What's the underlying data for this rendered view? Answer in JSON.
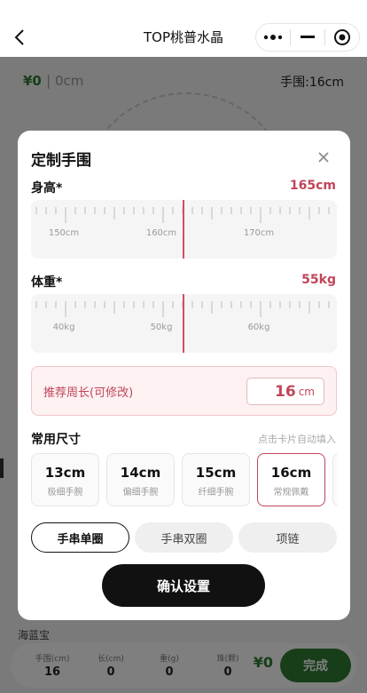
{
  "header": {
    "title": "TOP桃普水晶",
    "capsule": [
      "more-icon",
      "minimize-icon",
      "target-icon"
    ]
  },
  "background": {
    "price": "¥0",
    "length": "0cm",
    "wrist": "手围:16cm",
    "category": "海蓝宝",
    "stats": [
      {
        "label": "手围(cm)",
        "value": "16"
      },
      {
        "label": "长(cm)",
        "value": "0"
      },
      {
        "label": "重(g)",
        "value": "0"
      },
      {
        "label": "珠(颗)",
        "value": "0"
      }
    ],
    "total": "¥0",
    "done_label": "完成"
  },
  "modal": {
    "title": "定制手围",
    "height": {
      "label": "身高*",
      "value": "165cm",
      "tick_labels": [
        "150cm",
        "160cm",
        "170cm"
      ]
    },
    "weight": {
      "label": "体重*",
      "value": "55kg",
      "tick_labels": [
        "40kg",
        "50kg",
        "60kg"
      ]
    },
    "recommend": {
      "label": "推荐周长(可修改)",
      "value": "16",
      "unit": "cm"
    },
    "sizes": {
      "title": "常用尺寸",
      "hint": "点击卡片自动填入",
      "items": [
        {
          "value": "13cm",
          "label": "极细手腕"
        },
        {
          "value": "14cm",
          "label": "偏细手腕"
        },
        {
          "value": "15cm",
          "label": "纤细手腕"
        },
        {
          "value": "16cm",
          "label": "常规佩戴"
        }
      ]
    },
    "types": [
      "手串单圈",
      "手串双圈",
      "项链"
    ],
    "confirm_label": "确认设置"
  },
  "colors": {
    "accent": "#c0455a",
    "green": "#2e7d32",
    "dark": "#111111"
  }
}
